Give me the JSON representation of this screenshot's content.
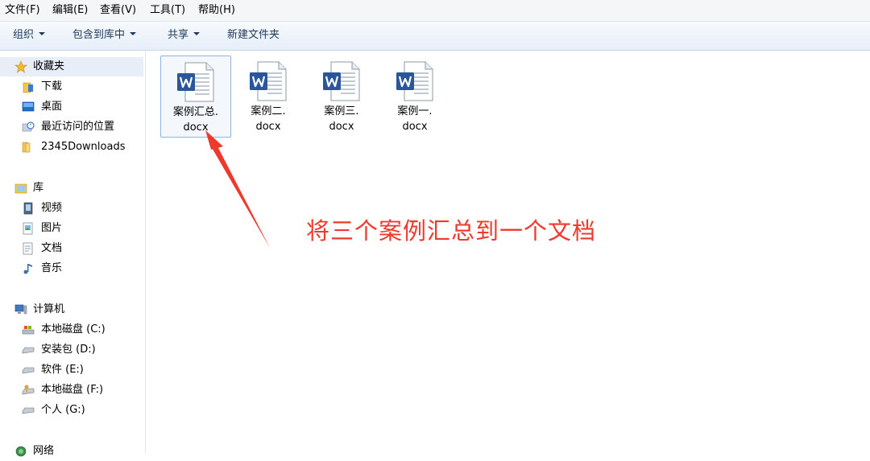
{
  "menubar": {
    "items": [
      "文件(F)",
      "编辑(E)",
      "查看(V)",
      "工具(T)",
      "帮助(H)"
    ]
  },
  "toolbar": {
    "organize": "组织",
    "include_in_library": "包含到库中",
    "share": "共享",
    "new_folder": "新建文件夹"
  },
  "nav": {
    "favorites": {
      "label": "收藏夹",
      "items": [
        "下载",
        "桌面",
        "最近访问的位置",
        "2345Downloads"
      ]
    },
    "libraries": {
      "label": "库",
      "items": [
        "视频",
        "图片",
        "文档",
        "音乐"
      ]
    },
    "computer": {
      "label": "计算机",
      "items": [
        "本地磁盘 (C:)",
        "安装包 (D:)",
        "软件 (E:)",
        "本地磁盘 (F:)",
        "个人 (G:)"
      ]
    },
    "network": {
      "label": "网络"
    }
  },
  "files": [
    {
      "line1": "案例汇总.",
      "line2": "docx"
    },
    {
      "line1": "案例二.",
      "line2": "docx"
    },
    {
      "line1": "案例三.",
      "line2": "docx"
    },
    {
      "line1": "案例一.",
      "line2": "docx"
    }
  ],
  "annotation": {
    "text": "将三个案例汇总到一个文档",
    "color": "#ee3a2c"
  },
  "colors": {
    "word_blue": "#2b579a",
    "selection": "#e7eef8",
    "accent_text": "#1e395b"
  }
}
